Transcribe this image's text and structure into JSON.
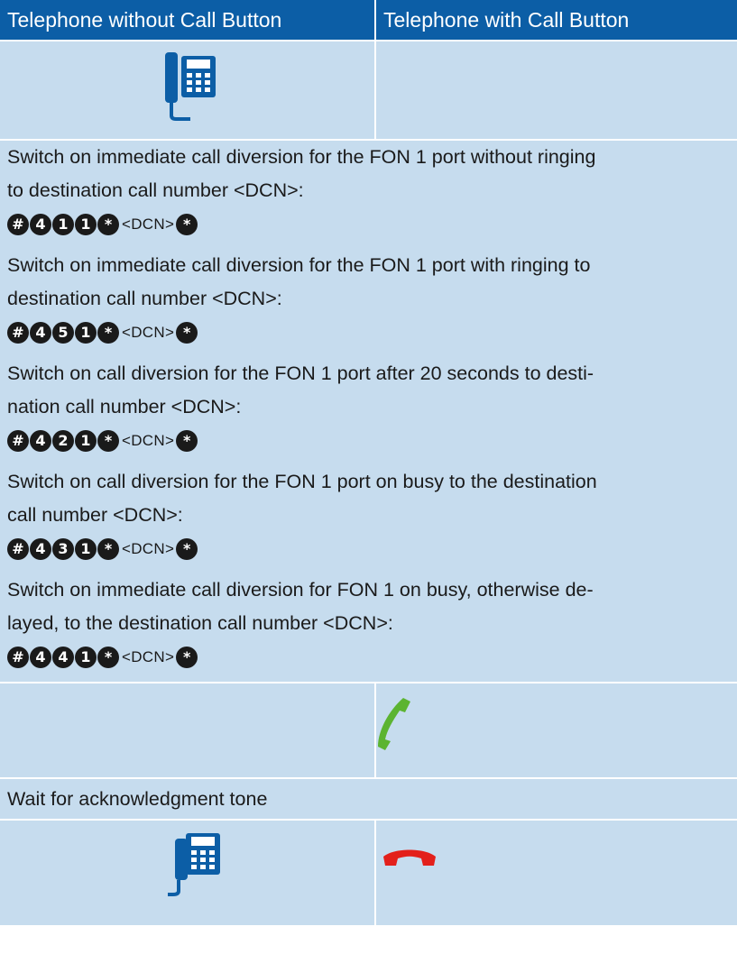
{
  "columns": {
    "without_button": "Telephone without Call Button",
    "with_button": "Telephone with Call Button"
  },
  "icons": {
    "phone_top": "desk-phone-icon",
    "pickup": "handset-pickup-icon",
    "phone_bottom": "desk-phone-icon",
    "hangup": "handset-hangup-icon"
  },
  "colors": {
    "header": "#0c5ea6",
    "band": "#c6dcee",
    "phone": "#0c5ea6",
    "pickup": "#5cb431",
    "hangup": "#e3201b"
  },
  "instructions": [
    {
      "line1": "Switch on immediate call diversion for the FON 1 port without ringing",
      "line2": "to destination call number <DCN>:",
      "keys": [
        "#",
        "4",
        "1",
        "1",
        "*"
      ],
      "dcn": "<DCN>",
      "end": "*"
    },
    {
      "line1": "Switch on immediate call diversion for the FON 1 port with ringing to",
      "line2": "destination call number <DCN>:",
      "keys": [
        "#",
        "4",
        "5",
        "1",
        "*"
      ],
      "dcn": "<DCN>",
      "end": "*"
    },
    {
      "line1": "Switch on call diversion for the FON 1 port after 20 seconds to desti-",
      "line2": "nation call number <DCN>:",
      "keys": [
        "#",
        "4",
        "2",
        "1",
        "*"
      ],
      "dcn": "<DCN>",
      "end": "*"
    },
    {
      "line1": "Switch on call diversion for the FON 1 port on busy to the destination",
      "line2": "call number <DCN>:",
      "keys": [
        "#",
        "4",
        "3",
        "1",
        "*"
      ],
      "dcn": "<DCN>",
      "end": "*"
    },
    {
      "line1": "Switch on immediate call diversion for FON 1 on busy, otherwise de-",
      "line2": "layed, to the destination call number <DCN>:",
      "keys": [
        "#",
        "4",
        "4",
        "1",
        "*"
      ],
      "dcn": "<DCN>",
      "end": "*"
    }
  ],
  "wait_text": "Wait for acknowledgment tone"
}
